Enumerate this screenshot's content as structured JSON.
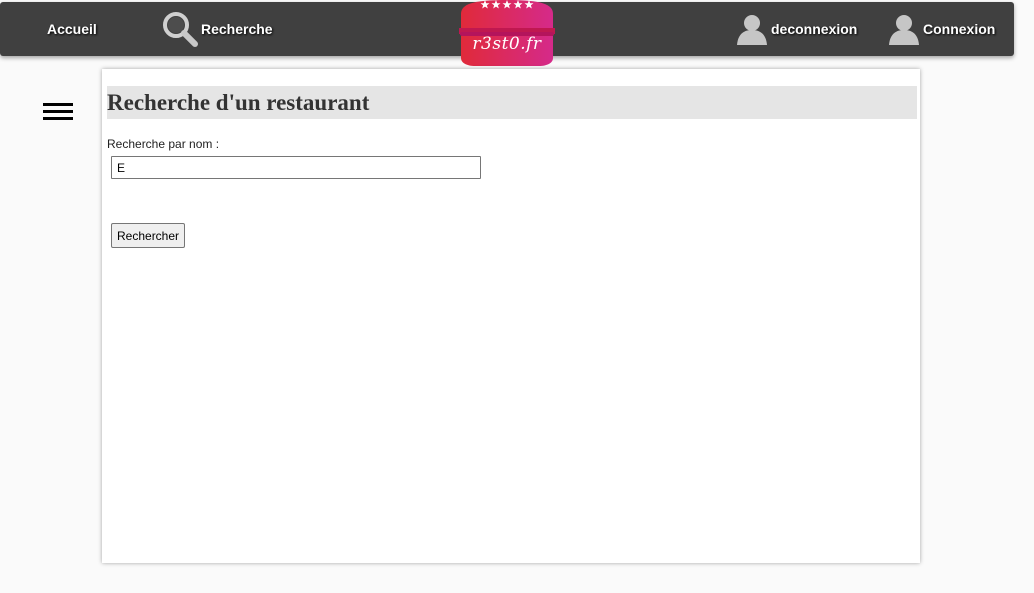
{
  "nav": {
    "accueil": "Accueil",
    "recherche": "Recherche",
    "deconnexion": "deconnexion",
    "connexion": "Connexion"
  },
  "logo": {
    "text": "r3st0.fr",
    "icon": "burger-logo-icon",
    "colors": {
      "top": "#d6205a",
      "bottom": "#e52570",
      "stars": "#ffffff"
    }
  },
  "menu": {
    "icon": "hamburger-menu-icon"
  },
  "page": {
    "title": "Recherche d'un restaurant",
    "label": "Recherche par nom :",
    "input_value": "E",
    "button_label": "Rechercher"
  },
  "colors": {
    "topbar": "#404040",
    "page_bg": "#fafafa",
    "title_bg": "#e5e5e5"
  }
}
